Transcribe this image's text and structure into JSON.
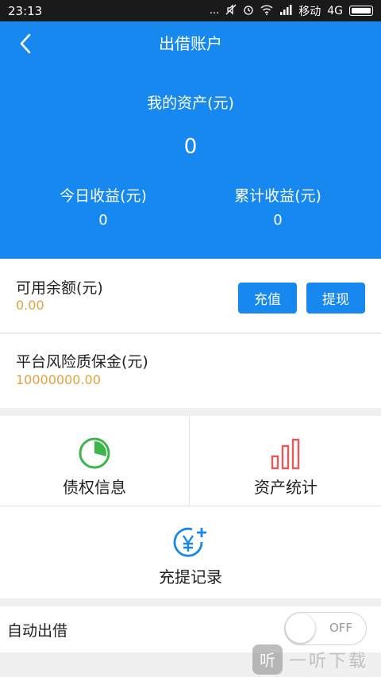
{
  "status_bar": {
    "time": "23:13",
    "dots": "...",
    "carrier": "移动",
    "network": "4G"
  },
  "header": {
    "title": "出借账户",
    "back_icon": "chevron-left-icon"
  },
  "summary": {
    "assets_label": "我的资产(元)",
    "assets_value": "0",
    "today_label": "今日收益(元)",
    "today_value": "0",
    "total_label": "累计收益(元)",
    "total_value": "0"
  },
  "balance": {
    "label": "可用余额(元)",
    "value": "0.00",
    "recharge_label": "充值",
    "withdraw_label": "提现"
  },
  "guarantee": {
    "label": "平台风险质保金(元)",
    "value": "10000000.00"
  },
  "menu": {
    "debt_label": "债权信息",
    "stats_label": "资产统计",
    "records_label": "充提记录"
  },
  "auto_lend": {
    "label": "自动出借",
    "toggle_state": "OFF",
    "enabled": false
  },
  "watermark": {
    "logo": "听",
    "text": "一听下载"
  },
  "colors": {
    "primary": "#1688f0",
    "amount": "#e2a23c",
    "debt_icon": "#3cb54a",
    "stats_icon": "#e85a5a",
    "records_icon": "#1688f0"
  }
}
